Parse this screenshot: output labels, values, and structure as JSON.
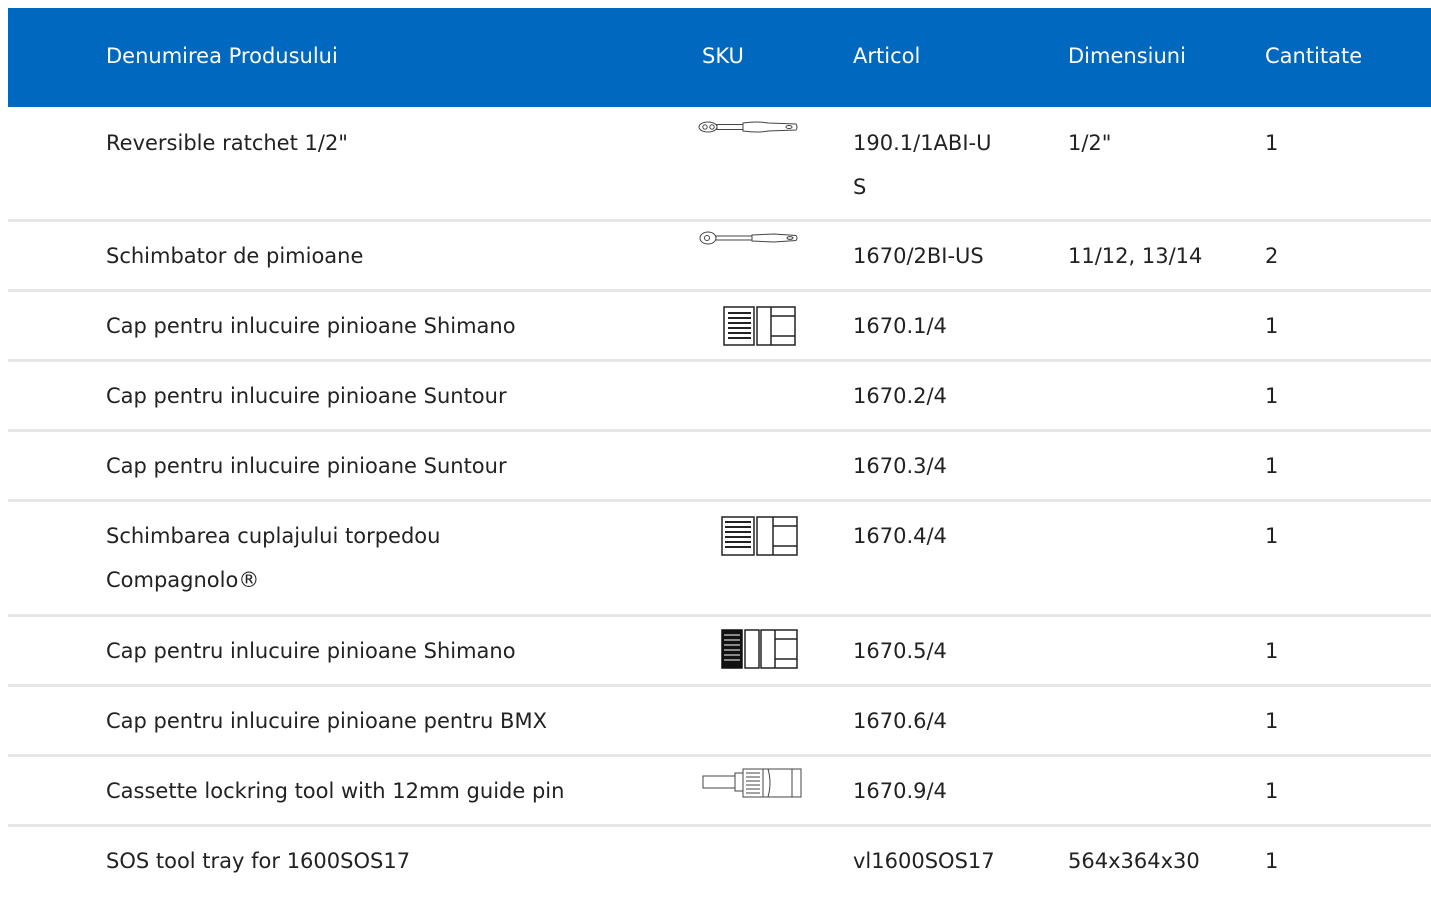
{
  "table": {
    "headers": {
      "name": "Denumirea Produsului",
      "sku": "SKU",
      "article": "Articol",
      "dimensions": "Dimensiuni",
      "quantity": "Cantitate"
    },
    "rows": [
      {
        "name": "Reversible ratchet 1/2\"",
        "article": "190.1/1ABI-US",
        "dimensions": "1/2\"",
        "quantity": "1",
        "sku_image": "ratchet-icon"
      },
      {
        "name": "Schimbator de pimioane",
        "article": "1670/2BI-US",
        "dimensions": "11/12, 13/14",
        "quantity": "2",
        "sku_image": "ratchet-small-icon"
      },
      {
        "name": "Cap pentru inlucuire pinioane Shimano",
        "article": "1670.1/4",
        "dimensions": "",
        "quantity": "1",
        "sku_image": "socket-icon"
      },
      {
        "name": "Cap pentru inlucuire pinioane Suntour",
        "article": "1670.2/4",
        "dimensions": "",
        "quantity": "1",
        "sku_image": ""
      },
      {
        "name": "Cap pentru inlucuire pinioane Suntour",
        "article": "1670.3/4",
        "dimensions": "",
        "quantity": "1",
        "sku_image": ""
      },
      {
        "name": "Schimbarea cuplajului torpedou Compagnolo®",
        "article": "1670.4/4",
        "dimensions": "",
        "quantity": "1",
        "sku_image": "socket-icon"
      },
      {
        "name": "Cap pentru inlucuire pinioane Shimano",
        "article": "1670.5/4",
        "dimensions": "",
        "quantity": "1",
        "sku_image": "socket-dark-icon"
      },
      {
        "name": "Cap pentru inlucuire pinioane pentru BMX",
        "article": "1670.6/4",
        "dimensions": "",
        "quantity": "1",
        "sku_image": ""
      },
      {
        "name": "Cassette lockring tool with 12mm guide pin",
        "article": "1670.9/4",
        "dimensions": "",
        "quantity": "1",
        "sku_image": "lockring-tool-icon"
      },
      {
        "name": "SOS tool tray for 1600SOS17",
        "article": "vl1600SOS17",
        "dimensions": "564x364x30",
        "quantity": "1",
        "sku_image": ""
      }
    ]
  },
  "colors": {
    "header_bg": "#0068bf",
    "header_text": "#ffffff",
    "row_divider": "#e6e6e6"
  }
}
